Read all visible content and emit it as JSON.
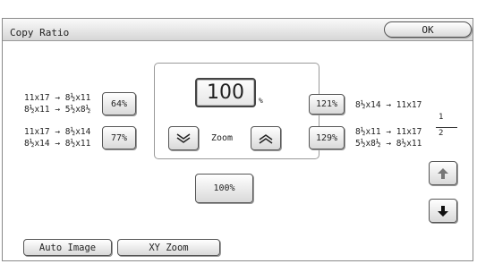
{
  "header": {
    "title": "Copy Ratio",
    "ok_label": "OK"
  },
  "reduce_presets": [
    {
      "label": "64%",
      "lines": [
        "11x17 → 8½x11",
        "8½x11 → 5½x8½"
      ]
    },
    {
      "label": "77%",
      "lines": [
        "11x17 → 8½x14",
        "8½x14 → 8½x11"
      ]
    }
  ],
  "enlarge_presets": [
    {
      "label": "121%",
      "lines": [
        "8½x14 → 11x17"
      ]
    },
    {
      "label": "129%",
      "lines": [
        "8½x11 → 11x17",
        "5½x8½ → 8½x11"
      ]
    }
  ],
  "zoom": {
    "value": "100",
    "unit": "%",
    "label": "Zoom"
  },
  "reset_label": "100%",
  "pager": {
    "current": "1",
    "total": "2"
  },
  "footer": {
    "auto_image": "Auto Image",
    "xy_zoom": "XY Zoom"
  },
  "icons": {
    "zoom_down": "chevron-double-down-icon",
    "zoom_up": "chevron-double-up-icon",
    "page_up": "arrow-up-icon",
    "page_down": "arrow-down-icon"
  }
}
